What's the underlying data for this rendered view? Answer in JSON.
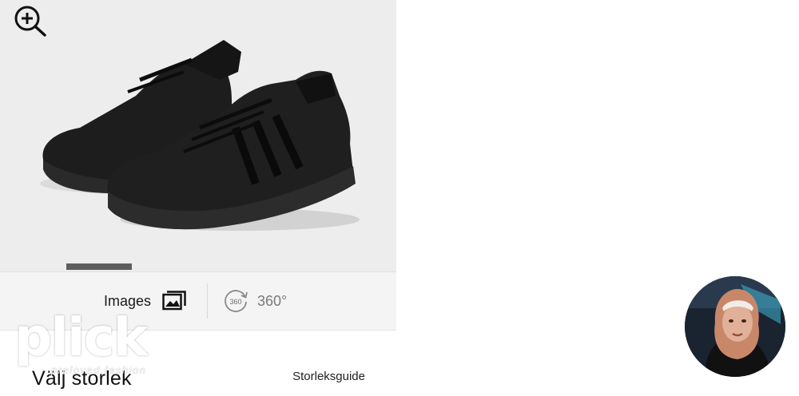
{
  "product": {
    "zoom_icon": "zoom-in-icon",
    "media_tabs": [
      {
        "label": "Images",
        "icon": "gallery-icon"
      },
      {
        "label": "360°",
        "icon": "rotate-360-icon",
        "icon_text": "360"
      }
    ],
    "size_section": {
      "title": "Välj storlek",
      "guide_link": "Storleksguide"
    }
  },
  "watermark": {
    "logo": "plick",
    "tagline": "preloved fashion"
  },
  "avatar": {
    "icon": "avatar"
  },
  "colors": {
    "image_bg": "#ededed",
    "tab_bar_bg": "#f4f4f4",
    "indicator": "#5e5e5e",
    "text": "#111111"
  }
}
